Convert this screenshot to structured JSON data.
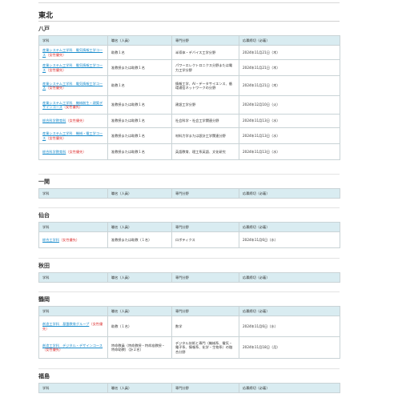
{
  "region": "東北",
  "headers": [
    "学科",
    "職名（人員）",
    "専門分野",
    "応募締切（必着）"
  ],
  "sections": [
    {
      "name": "八戸",
      "rows": [
        {
          "dept": "産業システム工学科　電気情報工学コース",
          "pref": "（女性優先）",
          "position": "助教１名",
          "field": "半導体・デバイス工学分野",
          "deadline": "2024年11月21日（木）"
        },
        {
          "dept": "産業システム工学科　電気情報工学コース",
          "pref": "（女性優先）",
          "position": "准教授または助教１名",
          "field": "パワーエレクトロニクス分野または電力工学分野",
          "deadline": "2024年11月21日（木）"
        },
        {
          "dept": "産業システム工学科　電気情報工学コース",
          "pref": "（女性優先）",
          "position": "助教１名",
          "field": "情報工学、AI・データサイエンス、循環通信ネットワークの分野",
          "deadline": "2024年11月21日（木）"
        },
        {
          "dept": "産業システム工学科　機械創生・建築デザインコース",
          "pref": "（女性優先）",
          "position": "准教授または助教１名",
          "field": "建設工学分野",
          "deadline": "2024年12月10日（火）"
        },
        {
          "dept": "総合科学教育科",
          "pref": "（女性優先）",
          "position": "准教授または助教１名",
          "field": "社会科学・社会工学関連分野",
          "deadline": "2024年11月13日（水）"
        },
        {
          "dept": "産業システム工学科　機械・電工学コース",
          "pref": "（女性優先）",
          "position": "准教授または助教１名",
          "field": "材料力学または設計工学関連分野",
          "deadline": "2024年11月13日（水）"
        },
        {
          "dept": "総合科学教育科",
          "pref": "（女性優先）",
          "position": "准教授または助教１名",
          "field": "英語教育、理工系英語、文化研究",
          "deadline": "2024年11月13日（水）"
        }
      ]
    },
    {
      "name": "一関",
      "rows": []
    },
    {
      "name": "仙台",
      "rows": [
        {
          "dept": "総合工学科",
          "pref": "（女性優先）",
          "position": "准教授または助教（１名）",
          "field": "ロボティクス",
          "deadline": "2024年11月6日（水）"
        }
      ]
    },
    {
      "name": "秋田",
      "rows": []
    },
    {
      "name": "鶴岡",
      "rows": [
        {
          "dept": "創造工学科　基盤教育グループ",
          "pref": "（女性優先）",
          "position": "助教（１名）",
          "field": "数学",
          "deadline": "2024年11月6日（水）"
        },
        {
          "dept": "創造工学科　デジタル・デザインコース",
          "pref": "（女性優先）",
          "position": "特命教員（特命教授・特命准教授・特命助教）（計２名）",
          "field": "デジタル技術と専門（機械系、電気・電子系、情報系、化学・生物系）の融合分野",
          "deadline": "2024年11月18日（月）"
        }
      ]
    },
    {
      "name": "福島",
      "rows": []
    }
  ]
}
